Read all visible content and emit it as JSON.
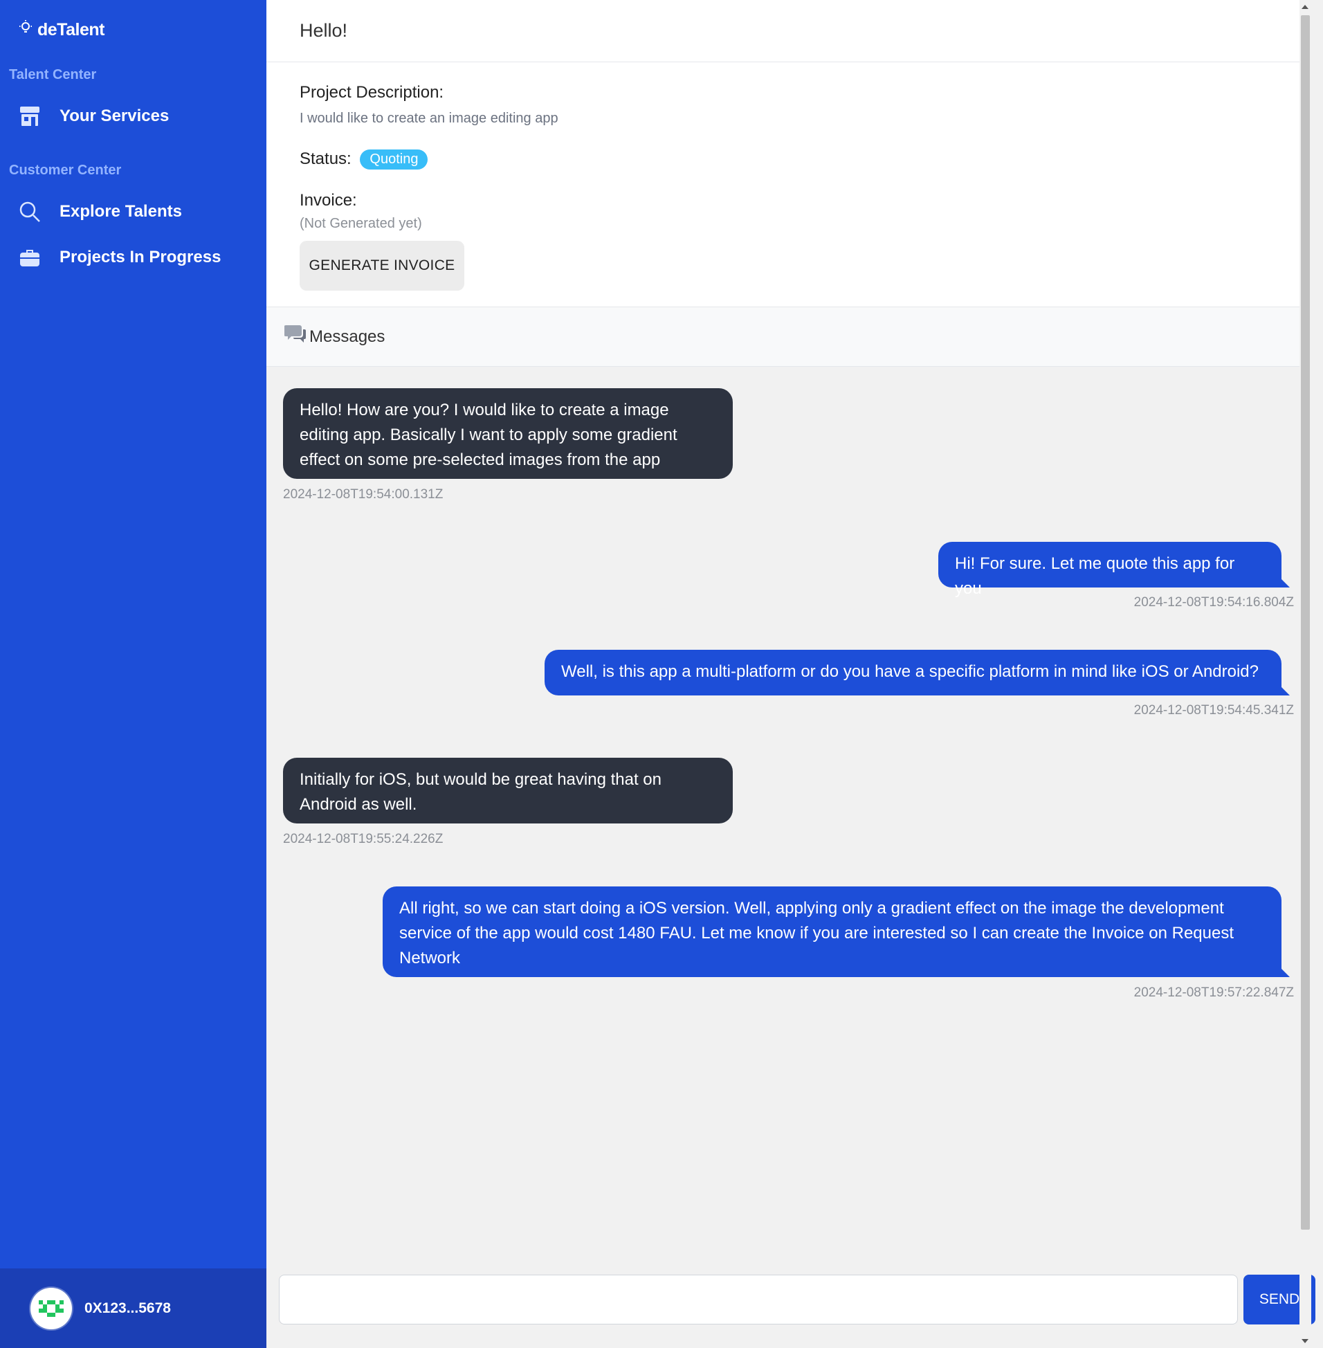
{
  "app": {
    "name": "deTalent"
  },
  "sidebar": {
    "talent_center_label": "Talent Center",
    "customer_center_label": "Customer Center",
    "items": [
      {
        "label": "Your Services",
        "icon": "store-icon"
      },
      {
        "label": "Explore Talents",
        "icon": "search-icon"
      },
      {
        "label": "Projects In Progress",
        "icon": "briefcase-icon"
      }
    ],
    "wallet_address": "0X123...5678"
  },
  "project": {
    "title": "Hello!",
    "description_label": "Project Description:",
    "description": "I would like to create an image editing app",
    "status_label": "Status:",
    "status": "Quoting",
    "invoice_label": "Invoice:",
    "invoice_value": "(Not Generated yet)",
    "generate_button": "GENERATE INVOICE"
  },
  "messages": {
    "header": "Messages",
    "items": [
      {
        "direction": "in",
        "text": "Hello! How are you? I would like to create a image editing app. Basically I want to apply some gradient effect on some pre-selected images from the app",
        "timestamp": "2024-12-08T19:54:00.131Z"
      },
      {
        "direction": "out",
        "text": "Hi! For sure. Let me quote this app for you",
        "timestamp": "2024-12-08T19:54:16.804Z"
      },
      {
        "direction": "out",
        "text": "Well, is this app a multi-platform or do you have a specific platform in mind like iOS or Android?",
        "timestamp": "2024-12-08T19:54:45.341Z"
      },
      {
        "direction": "in",
        "text": "Initially for iOS, but would be great having that on Android as well.",
        "timestamp": "2024-12-08T19:55:24.226Z"
      },
      {
        "direction": "out",
        "text": "All right, so we can start doing a iOS version. Well, applying only a gradient effect on the image the development service of the app would cost 1480 FAU. Let me know if you are interested so I can create the Invoice on Request Network",
        "timestamp": "2024-12-08T19:57:22.847Z"
      }
    ]
  },
  "composer": {
    "input_value": "",
    "send_label": "SEND"
  },
  "colors": {
    "sidebar": "#1d4ed8",
    "outgoing": "#1d4ed8",
    "incoming": "#2d3340",
    "status_badge": "#38bdf8"
  }
}
